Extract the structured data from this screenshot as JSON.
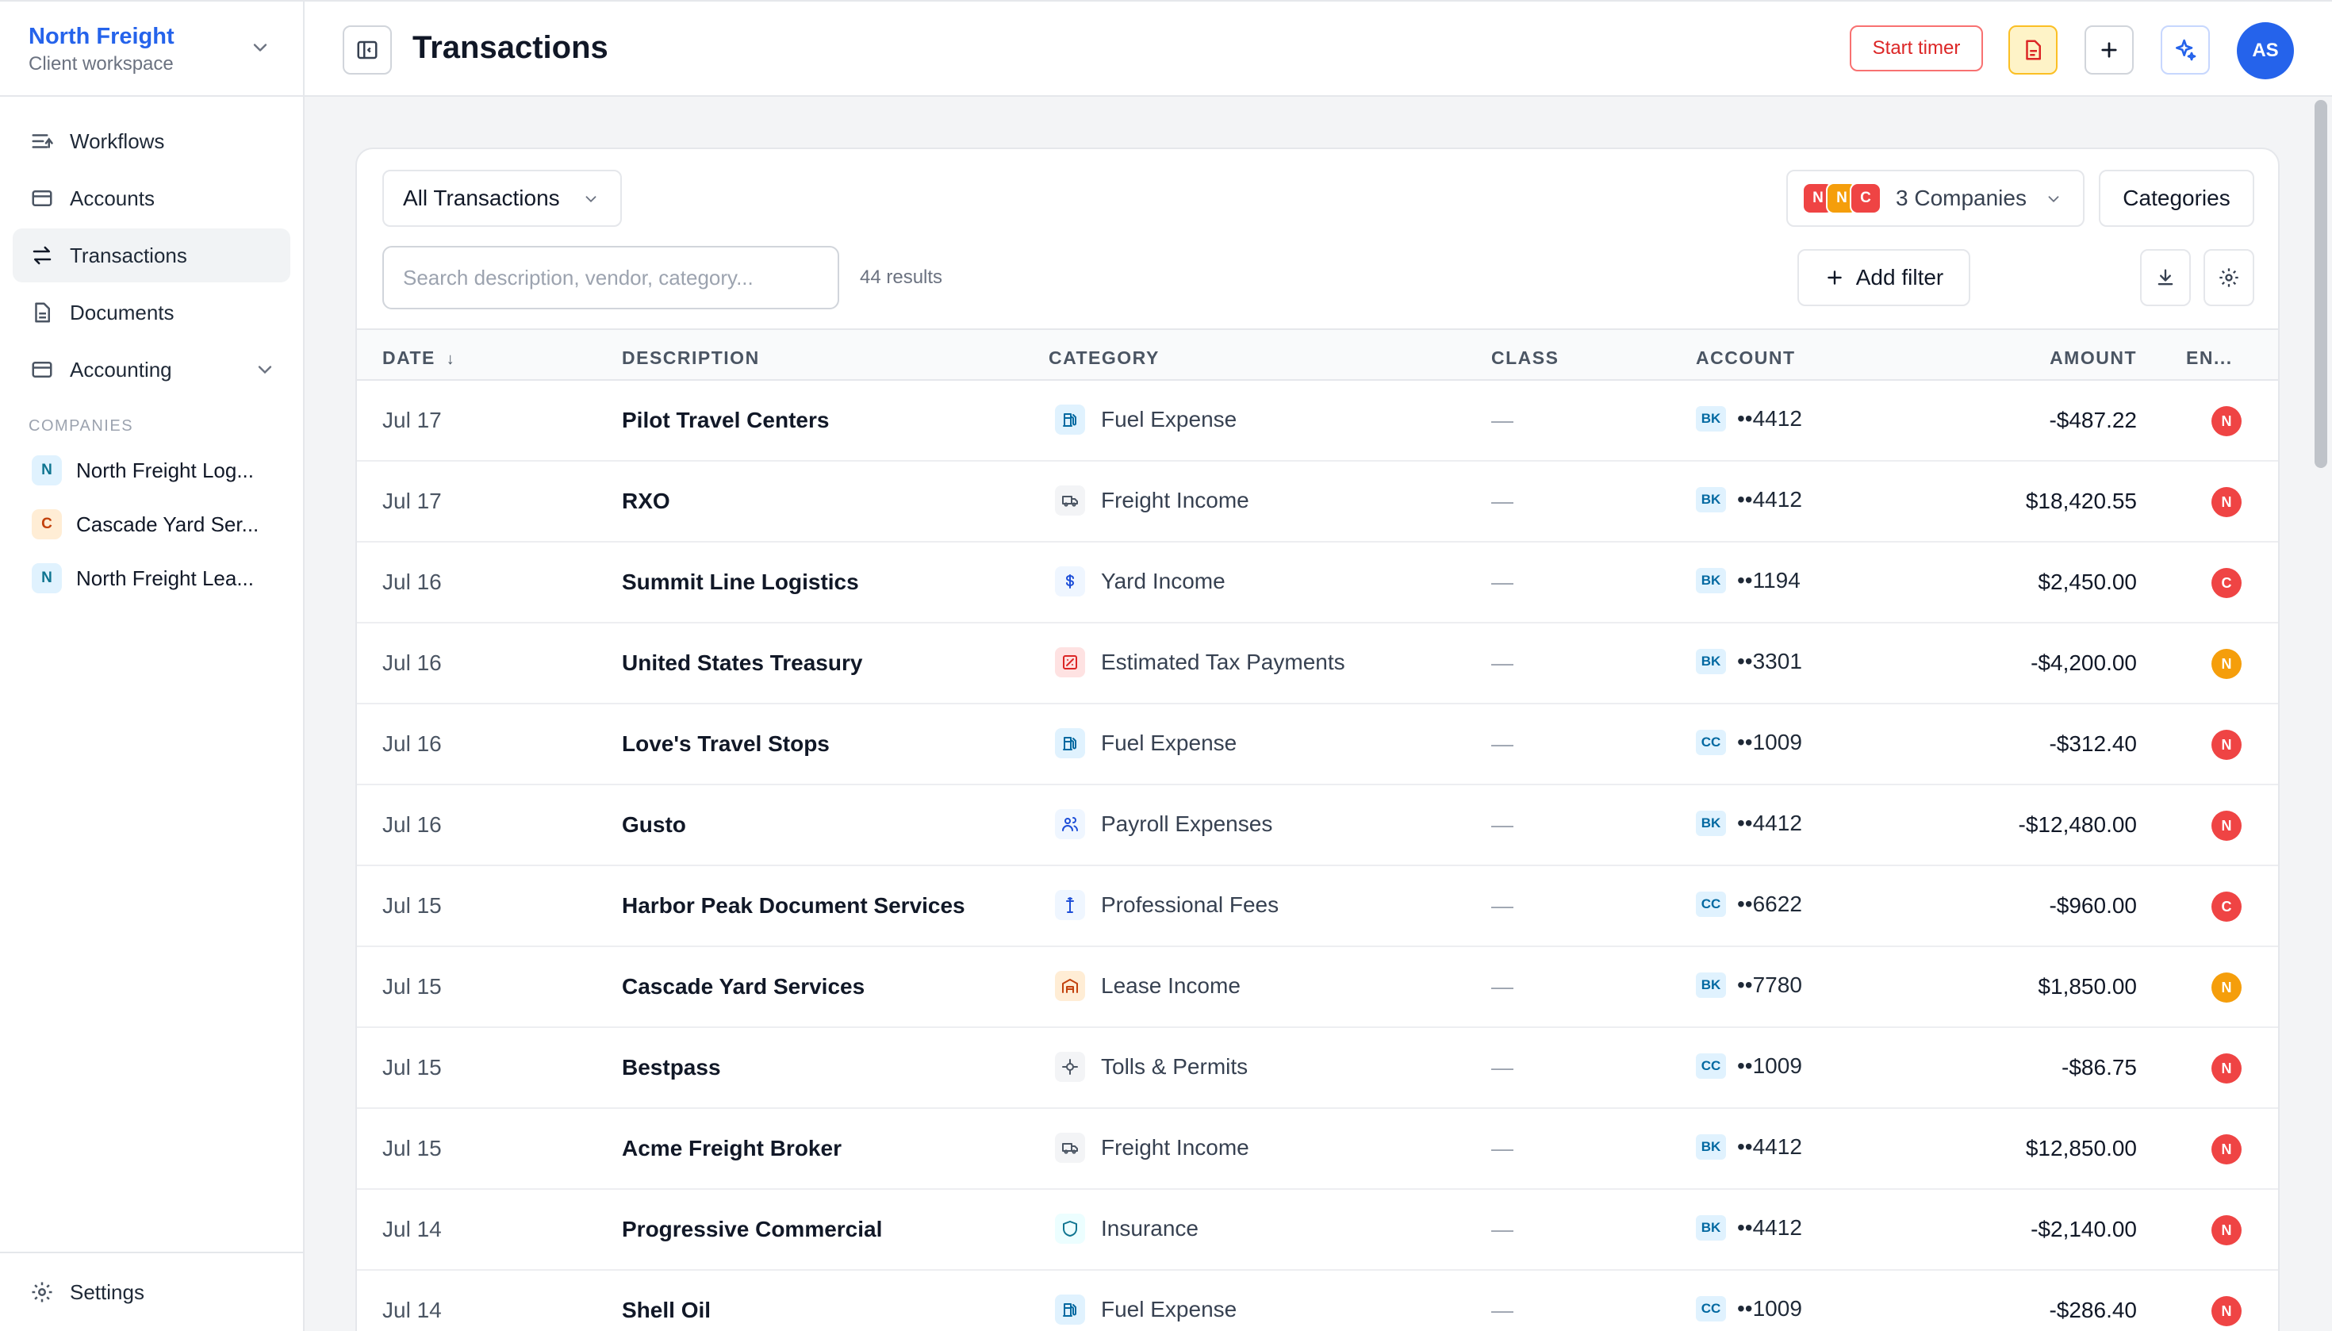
{
  "workspace": {
    "name": "North Freight",
    "subtitle": "Client workspace"
  },
  "nav": [
    {
      "label": "Workflows",
      "icon": "workflows-icon",
      "active": false
    },
    {
      "label": "Accounts",
      "icon": "accounts-icon",
      "active": false
    },
    {
      "label": "Transactions",
      "icon": "transactions-icon",
      "active": true
    },
    {
      "label": "Documents",
      "icon": "documents-icon",
      "active": false
    },
    {
      "label": "Accounting",
      "icon": "accounting-icon",
      "active": false,
      "expandable": true
    }
  ],
  "companies_section_label": "COMPANIES",
  "companies": [
    {
      "initial": "N",
      "label": "North Freight Log...",
      "bg": "#e0f2fe",
      "fg": "#0e7490"
    },
    {
      "initial": "C",
      "label": "Cascade Yard Ser...",
      "bg": "#ffedd5",
      "fg": "#c2410c"
    },
    {
      "initial": "N",
      "label": "North Freight Lea...",
      "bg": "#e0f2fe",
      "fg": "#0e7490"
    }
  ],
  "settings_label": "Settings",
  "header": {
    "title": "Transactions",
    "start_timer": "Start timer",
    "avatar_initials": "AS"
  },
  "toolbar": {
    "all_transactions": "All Transactions",
    "companies_label": "3 Companies",
    "company_badges": [
      {
        "initial": "N",
        "color": "#ef4444"
      },
      {
        "initial": "N",
        "color": "#f59e0b"
      },
      {
        "initial": "C",
        "color": "#ef4444"
      }
    ],
    "categories": "Categories",
    "search_placeholder": "Search description, vendor, category...",
    "results": "44 results",
    "add_filter": "Add filter"
  },
  "table": {
    "columns": [
      "DATE",
      "DESCRIPTION",
      "CATEGORY",
      "CLASS",
      "ACCOUNT",
      "AMOUNT",
      "EN..."
    ],
    "rows": [
      {
        "date": "Jul 17",
        "desc": "Pilot Travel Centers",
        "category": "Fuel Expense",
        "cat_icon": "fuel-pump-icon",
        "cat_bg": "#e0f2fe",
        "cat_fg": "#0369a1",
        "class": "—",
        "acct_type": "BK",
        "acct": "••4412",
        "amount": "-$487.22",
        "entity": "N",
        "entity_color": "#ef4444"
      },
      {
        "date": "Jul 17",
        "desc": "RXO",
        "category": "Freight Income",
        "cat_icon": "truck-icon",
        "cat_bg": "#f3f4f6",
        "cat_fg": "#4b5563",
        "class": "—",
        "acct_type": "BK",
        "acct": "••4412",
        "amount": "$18,420.55",
        "entity": "N",
        "entity_color": "#ef4444"
      },
      {
        "date": "Jul 16",
        "desc": "Summit Line Logistics",
        "category": "Yard Income",
        "cat_icon": "dollar-icon",
        "cat_bg": "#eff6ff",
        "cat_fg": "#1d4ed8",
        "class": "—",
        "acct_type": "BK",
        "acct": "••1194",
        "amount": "$2,450.00",
        "entity": "C",
        "entity_color": "#ef4444"
      },
      {
        "date": "Jul 16",
        "desc": "United States Treasury",
        "category": "Estimated Tax Payments",
        "cat_icon": "tax-receipt-icon",
        "cat_bg": "#fee2e2",
        "cat_fg": "#dc2626",
        "class": "—",
        "acct_type": "BK",
        "acct": "••3301",
        "amount": "-$4,200.00",
        "entity": "N",
        "entity_color": "#f59e0b"
      },
      {
        "date": "Jul 16",
        "desc": "Love's Travel Stops",
        "category": "Fuel Expense",
        "cat_icon": "fuel-pump-icon",
        "cat_bg": "#e0f2fe",
        "cat_fg": "#0369a1",
        "class": "—",
        "acct_type": "CC",
        "acct": "••1009",
        "amount": "-$312.40",
        "entity": "N",
        "entity_color": "#ef4444"
      },
      {
        "date": "Jul 16",
        "desc": "Gusto",
        "category": "Payroll Expenses",
        "cat_icon": "people-icon",
        "cat_bg": "#eff6ff",
        "cat_fg": "#1d4ed8",
        "class": "—",
        "acct_type": "BK",
        "acct": "••4412",
        "amount": "-$12,480.00",
        "entity": "N",
        "entity_color": "#ef4444"
      },
      {
        "date": "Jul 15",
        "desc": "Harbor Peak Document Services",
        "category": "Professional Fees",
        "cat_icon": "briefcase-icon",
        "cat_bg": "#eff6ff",
        "cat_fg": "#1d4ed8",
        "class": "—",
        "acct_type": "CC",
        "acct": "••6622",
        "amount": "-$960.00",
        "entity": "C",
        "entity_color": "#ef4444"
      },
      {
        "date": "Jul 15",
        "desc": "Cascade Yard Services",
        "category": "Lease Income",
        "cat_icon": "warehouse-icon",
        "cat_bg": "#ffedd5",
        "cat_fg": "#c2410c",
        "class": "—",
        "acct_type": "BK",
        "acct": "••7780",
        "amount": "$1,850.00",
        "entity": "N",
        "entity_color": "#f59e0b"
      },
      {
        "date": "Jul 15",
        "desc": "Bestpass",
        "category": "Tolls & Permits",
        "cat_icon": "toll-icon",
        "cat_bg": "#f3f4f6",
        "cat_fg": "#4b5563",
        "class": "—",
        "acct_type": "CC",
        "acct": "••1009",
        "amount": "-$86.75",
        "entity": "N",
        "entity_color": "#ef4444"
      },
      {
        "date": "Jul 15",
        "desc": "Acme Freight Broker",
        "category": "Freight Income",
        "cat_icon": "truck-icon",
        "cat_bg": "#f3f4f6",
        "cat_fg": "#4b5563",
        "class": "—",
        "acct_type": "BK",
        "acct": "••4412",
        "amount": "$12,850.00",
        "entity": "N",
        "entity_color": "#ef4444"
      },
      {
        "date": "Jul 14",
        "desc": "Progressive Commercial",
        "category": "Insurance",
        "cat_icon": "shield-icon",
        "cat_bg": "#ecfeff",
        "cat_fg": "#0e7490",
        "class": "—",
        "acct_type": "BK",
        "acct": "••4412",
        "amount": "-$2,140.00",
        "entity": "N",
        "entity_color": "#ef4444"
      },
      {
        "date": "Jul 14",
        "desc": "Shell Oil",
        "category": "Fuel Expense",
        "cat_icon": "fuel-pump-icon",
        "cat_bg": "#e0f2fe",
        "cat_fg": "#0369a1",
        "class": "—",
        "acct_type": "CC",
        "acct": "••1009",
        "amount": "-$286.40",
        "entity": "N",
        "entity_color": "#ef4444"
      }
    ]
  }
}
